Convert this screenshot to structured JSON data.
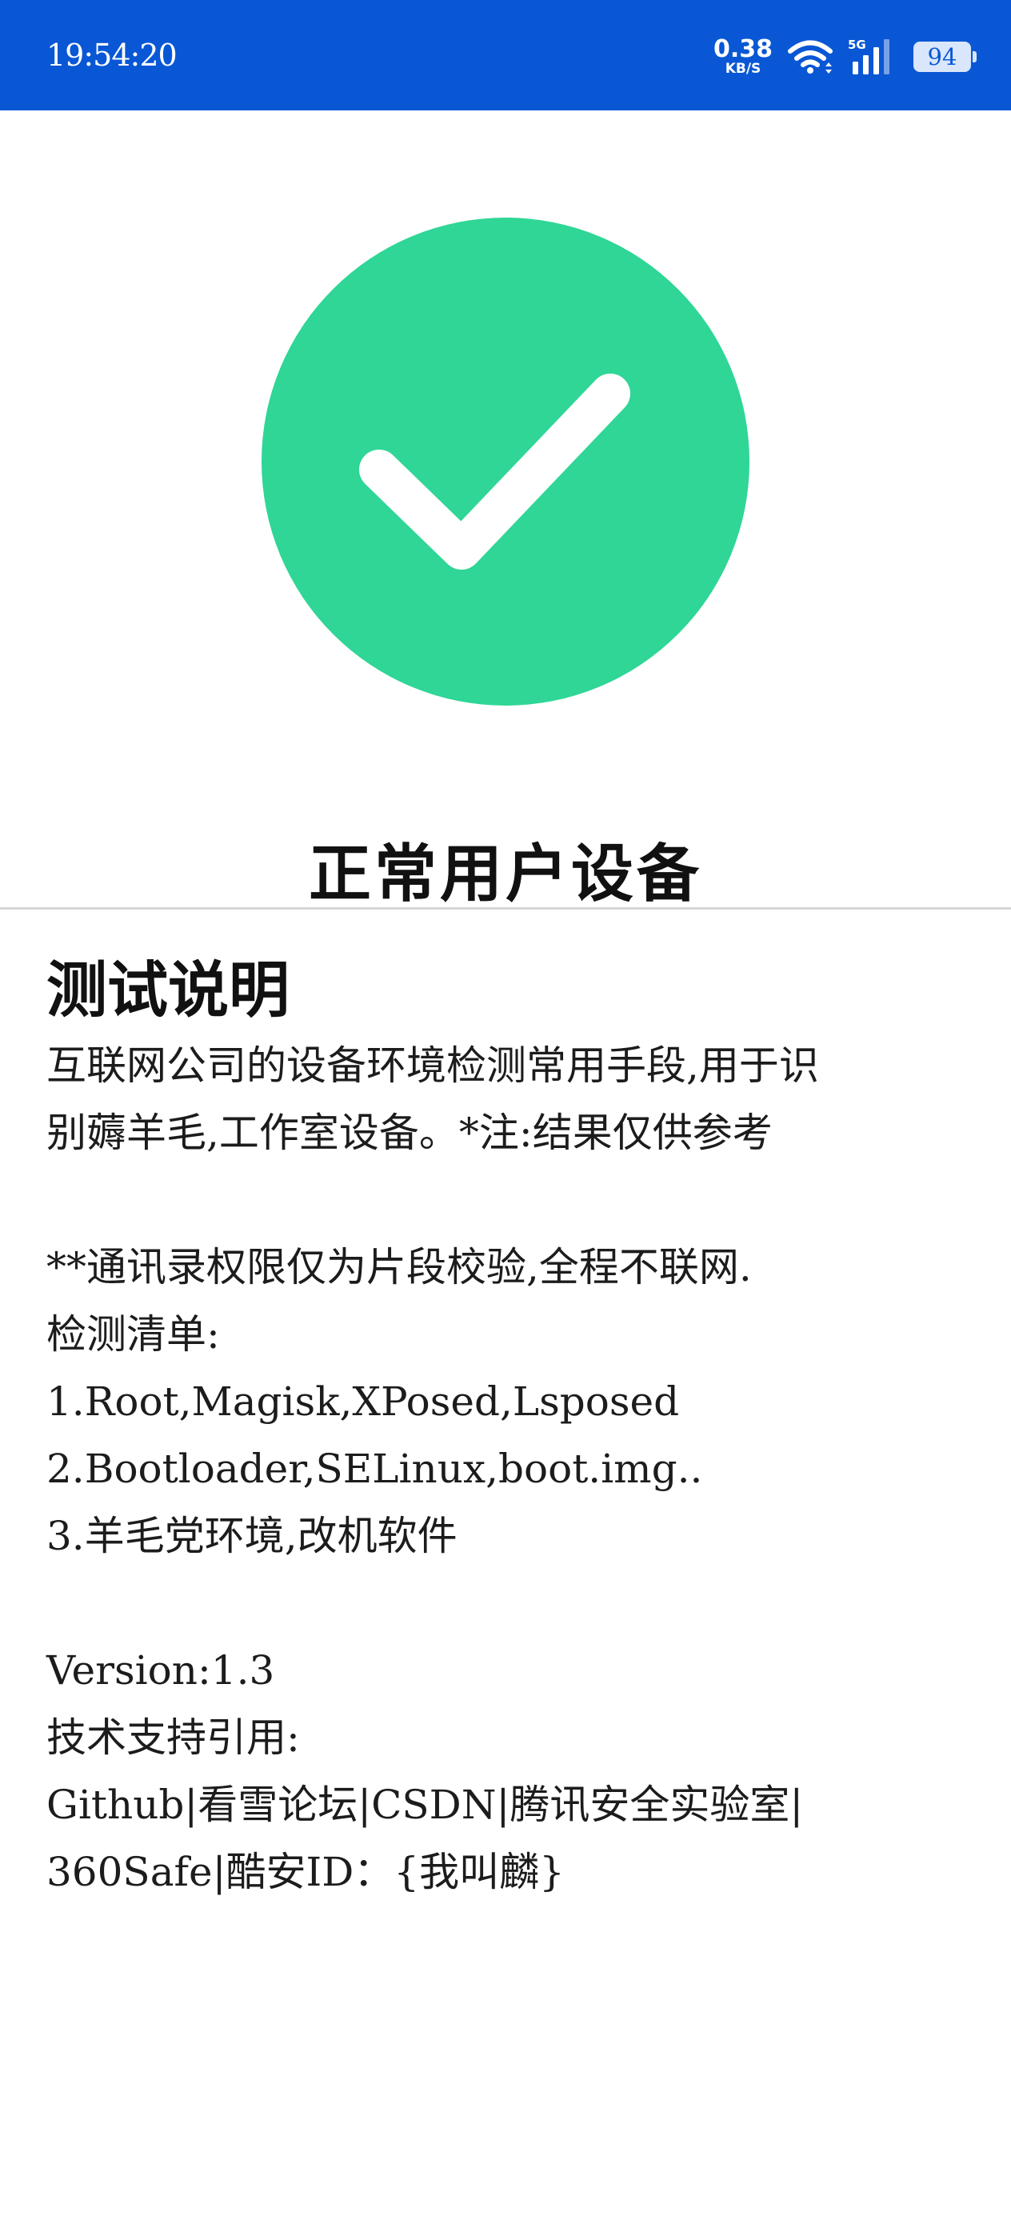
{
  "status_bar": {
    "time": "19:54:20",
    "net_speed_value": "0.38",
    "net_speed_unit": "KB/S",
    "network_type": "5G",
    "battery_level": "94",
    "background_color": "#0957d5"
  },
  "result": {
    "icon": "check-circle-icon",
    "icon_color": "#2fd696",
    "title": "正常用户设备"
  },
  "info": {
    "heading": "测试说明",
    "body": "互联网公司的设备环境检测常用手段,用于识\n别薅羊毛,工作室设备。*注:结果仅供参考\n\n**通讯录权限仅为片段校验,全程不联网.\n检测清单:\n1.Root,Magisk,XPosed,Lsposed\n2.Bootloader,SELinux,boot.img..\n3.羊毛党环境,改机软件\n\nVersion:1.3\n技术支持引用:\nGithub|看雪论坛|CSDN|腾讯安全实验室|\n360Safe|酷安ID：{我叫麟}"
  }
}
